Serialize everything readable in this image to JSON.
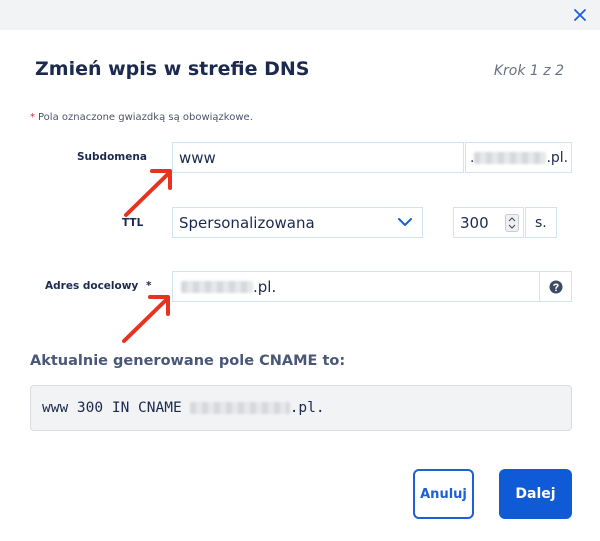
{
  "dialog": {
    "title": "Zmień wpis w strefie DNS",
    "step": "Krok 1 z 2",
    "required_note": "Pola oznaczone gwiazdką są obowiązkowe.",
    "required_star": "*"
  },
  "form": {
    "subdomain": {
      "label": "Subdomena",
      "value": "www",
      "suffix_prefix": ".",
      "suffix_tld": ".pl."
    },
    "ttl": {
      "label": "TTL",
      "selected": "Spersonalizowana",
      "value": "300",
      "unit": "s."
    },
    "target": {
      "label": "Adres docelowy",
      "required_star": "*",
      "value_tld": ".pl."
    }
  },
  "cname": {
    "heading": "Aktualnie generowane pole CNAME to:",
    "record_prefix": "www 300 IN CNAME",
    "record_suffix": ".pl."
  },
  "buttons": {
    "cancel": "Anuluj",
    "next": "Dalej"
  },
  "colors": {
    "accent": "#0f5bd7",
    "arrow": "#e8321e",
    "required": "#d13438"
  },
  "icons": {
    "close": "close-icon",
    "chevron": "chevron-down-icon",
    "spinner": "spinner-arrows-icon",
    "help": "question-circle-icon"
  }
}
